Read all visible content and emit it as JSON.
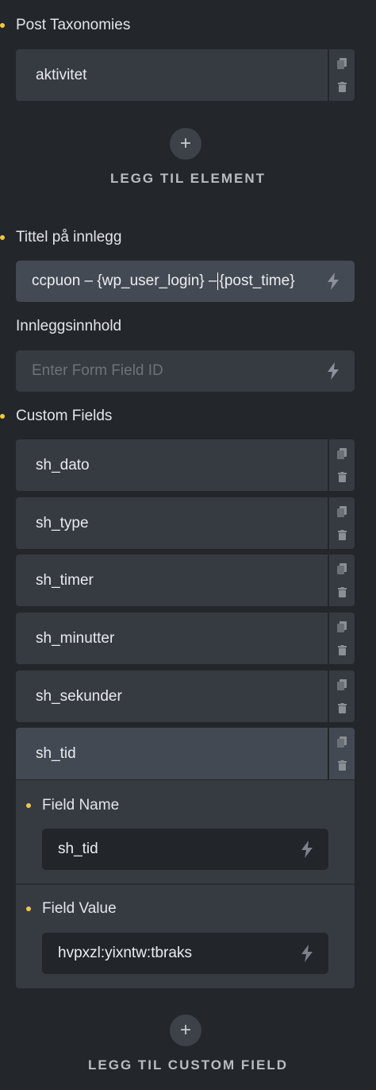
{
  "post_taxonomies": {
    "label": "Post Taxonomies",
    "items": [
      {
        "title": "aktivitet"
      }
    ],
    "add_label": "LEGG TIL ELEMENT"
  },
  "post_title": {
    "label": "Tittel på innlegg",
    "value_before_cursor": "ccpuon – {wp_user_login} –",
    "value_after_cursor": "{post_time}"
  },
  "post_content": {
    "label": "Innleggsinnhold",
    "placeholder": "Enter Form Field ID"
  },
  "custom_fields": {
    "label": "Custom Fields",
    "items": [
      {
        "title": "sh_dato"
      },
      {
        "title": "sh_type"
      },
      {
        "title": "sh_timer"
      },
      {
        "title": "sh_minutter"
      },
      {
        "title": "sh_sekunder"
      },
      {
        "title": "sh_tid"
      }
    ],
    "expanded": {
      "field_name_label": "Field Name",
      "field_name_value": "sh_tid",
      "field_value_label": "Field Value",
      "field_value_value": "hvpxzl:yixntw:tbraks"
    },
    "add_label": "LEGG TIL CUSTOM FIELD"
  },
  "icons": {
    "copy": "copy-icon",
    "trash": "trash-icon",
    "bolt": "dynamic-data-bolt-icon",
    "plus": "plus-icon"
  },
  "colors": {
    "background": "#23262a",
    "item": "#363b42",
    "item_active": "#434952",
    "input": "#3b4047",
    "sub_input": "#22252a",
    "dot": "#f0c845"
  }
}
